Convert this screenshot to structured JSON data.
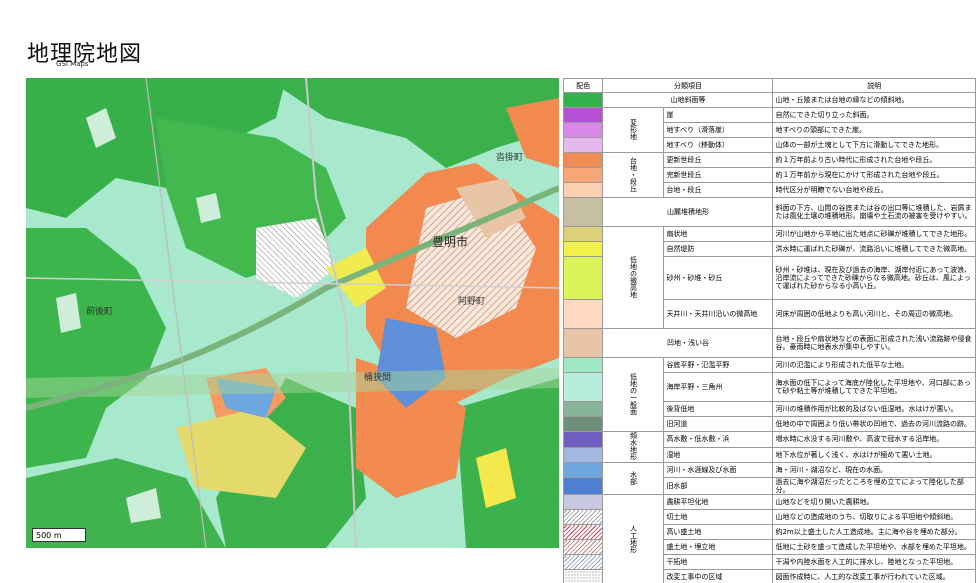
{
  "header": {
    "title": "地理院地図",
    "subtitle": "GSI Maps"
  },
  "map": {
    "scale_label": "500 m",
    "place_labels": [
      "豊明市",
      "沓掛町",
      "前後町",
      "阿野町",
      "桶狭間"
    ]
  },
  "legend": {
    "headers": [
      "配色",
      "分類項目",
      "説明"
    ],
    "rows": [
      {
        "group": "",
        "color": "#33b14a",
        "item": "山地斜面等",
        "desc": "山地・丘陵または台地の縁などの傾斜地。"
      },
      {
        "group": "変形地",
        "color": "#b44fd6",
        "item": "崖",
        "desc": "自然にできた切り立った斜面。"
      },
      {
        "group": "変形地",
        "color": "#d889e8",
        "item": "地すべり（滑落崖）",
        "desc": "地すべりの頭部にできた崖。"
      },
      {
        "group": "変形地",
        "color": "#e6b8ee",
        "item": "地すべり（移動体）",
        "desc": "山体の一部が土塊として下方に滑動してできた地形。"
      },
      {
        "group": "台地・段丘",
        "color": "#f28c55",
        "item": "更新世段丘",
        "desc": "約１万年前より古い時代に形成された台地や段丘。"
      },
      {
        "group": "台地・段丘",
        "color": "#f7a677",
        "item": "完新世段丘",
        "desc": "約１万年前から現在にかけて形成された台地や段丘。"
      },
      {
        "group": "台地・段丘",
        "color": "#fbd0b0",
        "item": "台地・段丘",
        "desc": "時代区分が明瞭でない台地や段丘。"
      },
      {
        "group": "",
        "color": "#c7bfa4",
        "item": "山麓堆積地形",
        "desc": "斜面の下方、山間の谷底または谷の出口等に堆積した、岩屑または風化土壌の堆積地形。崩壊や土石流の被害を受けやすい。"
      },
      {
        "group": "低地の微高地",
        "color": "#dcd07a",
        "item": "扇状地",
        "desc": "河川が山地から平地に出た地点に砂礫が堆積してできた地形。"
      },
      {
        "group": "低地の微高地",
        "color": "#f2f04a",
        "item": "自然堤防",
        "desc": "洪水時に運ばれた砂礫が、流路沿いに堆積してできた微高地。"
      },
      {
        "group": "低地の微高地",
        "color": "#d9f55a",
        "item": "砂州・砂堆・砂丘",
        "desc": "砂州・砂堆は、現在及び過去の海岸、湖岸付近にあって波浪、沿岸流によってできた砂礫からなる微高地。砂丘は、風によって運ばれた砂からなる小高い丘。"
      },
      {
        "group": "低地の微高地",
        "color": "#fcd9c0",
        "item": "天井川・天井川沿いの微高地",
        "desc": "河床が周囲の低地よりも高い河川と、その周辺の微高地。"
      },
      {
        "group": "",
        "color": "#e8c5a6",
        "item": "凹地・浅い谷",
        "desc": "台地・段丘や扇状地などの表面に形成された浅い流路跡や侵食谷。豪雨時に地表水が集中しやすい。"
      },
      {
        "group": "低地の一般面",
        "color": "#9fe8c3",
        "item": "谷底平野・氾濫平野",
        "desc": "河川の氾濫により形成された低平な土地。"
      },
      {
        "group": "低地の一般面",
        "color": "#b8eddc",
        "item": "海岸平野・三角州",
        "desc": "海水面の低下によって海底が陸化した平坦地や、河口部にあって砂や粘土等が堆積してできた平坦地。"
      },
      {
        "group": "低地の一般面",
        "color": "#86b59a",
        "item": "後背低地",
        "desc": "河川の堆積作用が比較的及ばない低湿地。水はけが悪い。"
      },
      {
        "group": "低地の一般面",
        "color": "#6f8f7a",
        "item": "旧河道",
        "desc": "低地の中で周囲より低い帯状の凹地で、過去の河川流路の跡。"
      },
      {
        "group": "頻水地形",
        "color": "#6d5fc0",
        "item": "高水敷・低水敷・浜",
        "desc": "増水時に水没する河川敷や、高波で冠水する沿岸地。"
      },
      {
        "group": "頻水地形",
        "color": "#a3b8e0",
        "item": "湿地",
        "desc": "地下水位が著しく浅く、水はけが極めて悪い土地。"
      },
      {
        "group": "水部",
        "color": "#6ea6e0",
        "item": "河川・水涯線及び水面",
        "desc": "海・河川・湖沼など、現在の水面。"
      },
      {
        "group": "水部",
        "color": "#4e7fd1",
        "item": "旧水部",
        "desc": "過去に海や湖沼だったところを埋め立てによって陸化した部分。"
      },
      {
        "group": "人工地形",
        "color": "hatch-e",
        "item": "農耕平坦化地",
        "desc": "山地などを切り開いた農耕地。"
      },
      {
        "group": "人工地形",
        "color": "hatch-a",
        "item": "切土地",
        "desc": "山地などの造成地のうち、切取りによる平坦地や傾斜地。"
      },
      {
        "group": "人工地形",
        "color": "hatch-c",
        "item": "高い盛土地",
        "desc": "約2m以上盛土した人工造成地。主に海や谷を埋めた部分。"
      },
      {
        "group": "人工地形",
        "color": "hatch-b",
        "item": "盛土地・埋立地",
        "desc": "低地に土砂を盛って造成した平坦地や、水部を埋めた平坦地。"
      },
      {
        "group": "人工地形",
        "color": "hatch-d",
        "item": "干拓地",
        "desc": "干潟や内陸水面を人工的に排水し、陸地となった平坦地。"
      },
      {
        "group": "人工地形",
        "color": "hatch-f",
        "item": "改変工事中の区域",
        "desc": "図面作成時に、人工的な改変工事が行われていた区域。"
      }
    ]
  }
}
